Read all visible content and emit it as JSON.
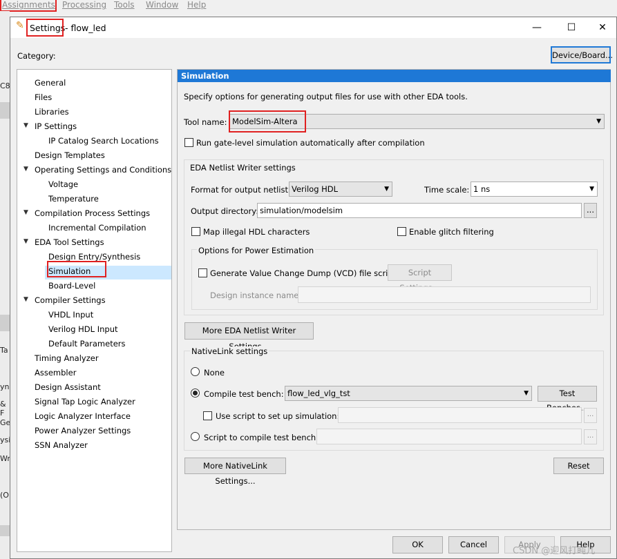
{
  "menubar": {
    "items": [
      "Assignments",
      "Processing",
      "Tools",
      "Window",
      "Help"
    ]
  },
  "bg_left": {
    "items": [
      "C8",
      "Ta",
      "yn",
      "& F",
      "Ge",
      "ysi",
      "Wr",
      "(O"
    ]
  },
  "dialog": {
    "title": "Settings",
    "title_suffix": " - flow_led",
    "min": "—",
    "max": "☐",
    "close": "✕",
    "category_label": "Category:",
    "device_board_button": "Device/Board...",
    "tree": [
      {
        "label": "General",
        "level": 0,
        "expand": false
      },
      {
        "label": "Files",
        "level": 0,
        "expand": false
      },
      {
        "label": "Libraries",
        "level": 0,
        "expand": false
      },
      {
        "label": "IP Settings",
        "level": 0,
        "expand": true
      },
      {
        "label": "IP Catalog Search Locations",
        "level": 1,
        "expand": false
      },
      {
        "label": "Design Templates",
        "level": 0,
        "expand": false
      },
      {
        "label": "Operating Settings and Conditions",
        "level": 0,
        "expand": true
      },
      {
        "label": "Voltage",
        "level": 1,
        "expand": false
      },
      {
        "label": "Temperature",
        "level": 1,
        "expand": false
      },
      {
        "label": "Compilation Process Settings",
        "level": 0,
        "expand": true
      },
      {
        "label": "Incremental Compilation",
        "level": 1,
        "expand": false
      },
      {
        "label": "EDA Tool Settings",
        "level": 0,
        "expand": true
      },
      {
        "label": "Design Entry/Synthesis",
        "level": 1,
        "expand": false
      },
      {
        "label": "Simulation",
        "level": 1,
        "expand": false,
        "selected": true
      },
      {
        "label": "Board-Level",
        "level": 1,
        "expand": false
      },
      {
        "label": "Compiler Settings",
        "level": 0,
        "expand": true
      },
      {
        "label": "VHDL Input",
        "level": 1,
        "expand": false
      },
      {
        "label": "Verilog HDL Input",
        "level": 1,
        "expand": false
      },
      {
        "label": "Default Parameters",
        "level": 1,
        "expand": false
      },
      {
        "label": "Timing Analyzer",
        "level": 0,
        "expand": false
      },
      {
        "label": "Assembler",
        "level": 0,
        "expand": false
      },
      {
        "label": "Design Assistant",
        "level": 0,
        "expand": false
      },
      {
        "label": "Signal Tap Logic Analyzer",
        "level": 0,
        "expand": false
      },
      {
        "label": "Logic Analyzer Interface",
        "level": 0,
        "expand": false
      },
      {
        "label": "Power Analyzer Settings",
        "level": 0,
        "expand": false
      },
      {
        "label": "SSN Analyzer",
        "level": 0,
        "expand": false
      }
    ],
    "panel": {
      "header": "Simulation",
      "description": "Specify options for generating output files for use with other EDA tools.",
      "tool_name_label": "Tool name:",
      "tool_name_value": "ModelSim-Altera",
      "run_gate_level_label": "Run gate-level simulation automatically after compilation",
      "eda_group_title": "EDA Netlist Writer settings",
      "format_label": "Format for output netlist:",
      "format_value": "Verilog HDL",
      "time_scale_label": "Time scale:",
      "time_scale_value": "1 ns",
      "output_dir_label": "Output directory:",
      "output_dir_value": "simulation/modelsim",
      "browse": "...",
      "map_illegal_label": "Map illegal HDL characters",
      "glitch_label": "Enable glitch filtering",
      "power_group_title": "Options for Power Estimation",
      "vcd_label": "Generate Value Change Dump (VCD) file script",
      "script_settings_button": "Script Settings...",
      "design_instance_label": "Design instance name:",
      "more_eda_button": "More EDA Netlist Writer Settings...",
      "nativelink_title": "NativeLink settings",
      "none_label": "None",
      "compile_tb_label": "Compile test bench:",
      "compile_tb_value": "flow_led_vlg_tst",
      "test_benches_button": "Test Benches...",
      "use_script_label": "Use script to set up simulation:",
      "script_compile_label": "Script to compile test bench:",
      "more_nativelink_button": "More NativeLink Settings...",
      "reset_button": "Reset"
    },
    "footer": {
      "ok": "OK",
      "cancel": "Cancel",
      "apply": "Apply",
      "help": "Help"
    }
  },
  "watermark": "CSDN @迎风打盹儿",
  "colors": {
    "highlight_red": "#e02020",
    "header_blue": "#1e78d6",
    "selection": "#cce8ff"
  }
}
